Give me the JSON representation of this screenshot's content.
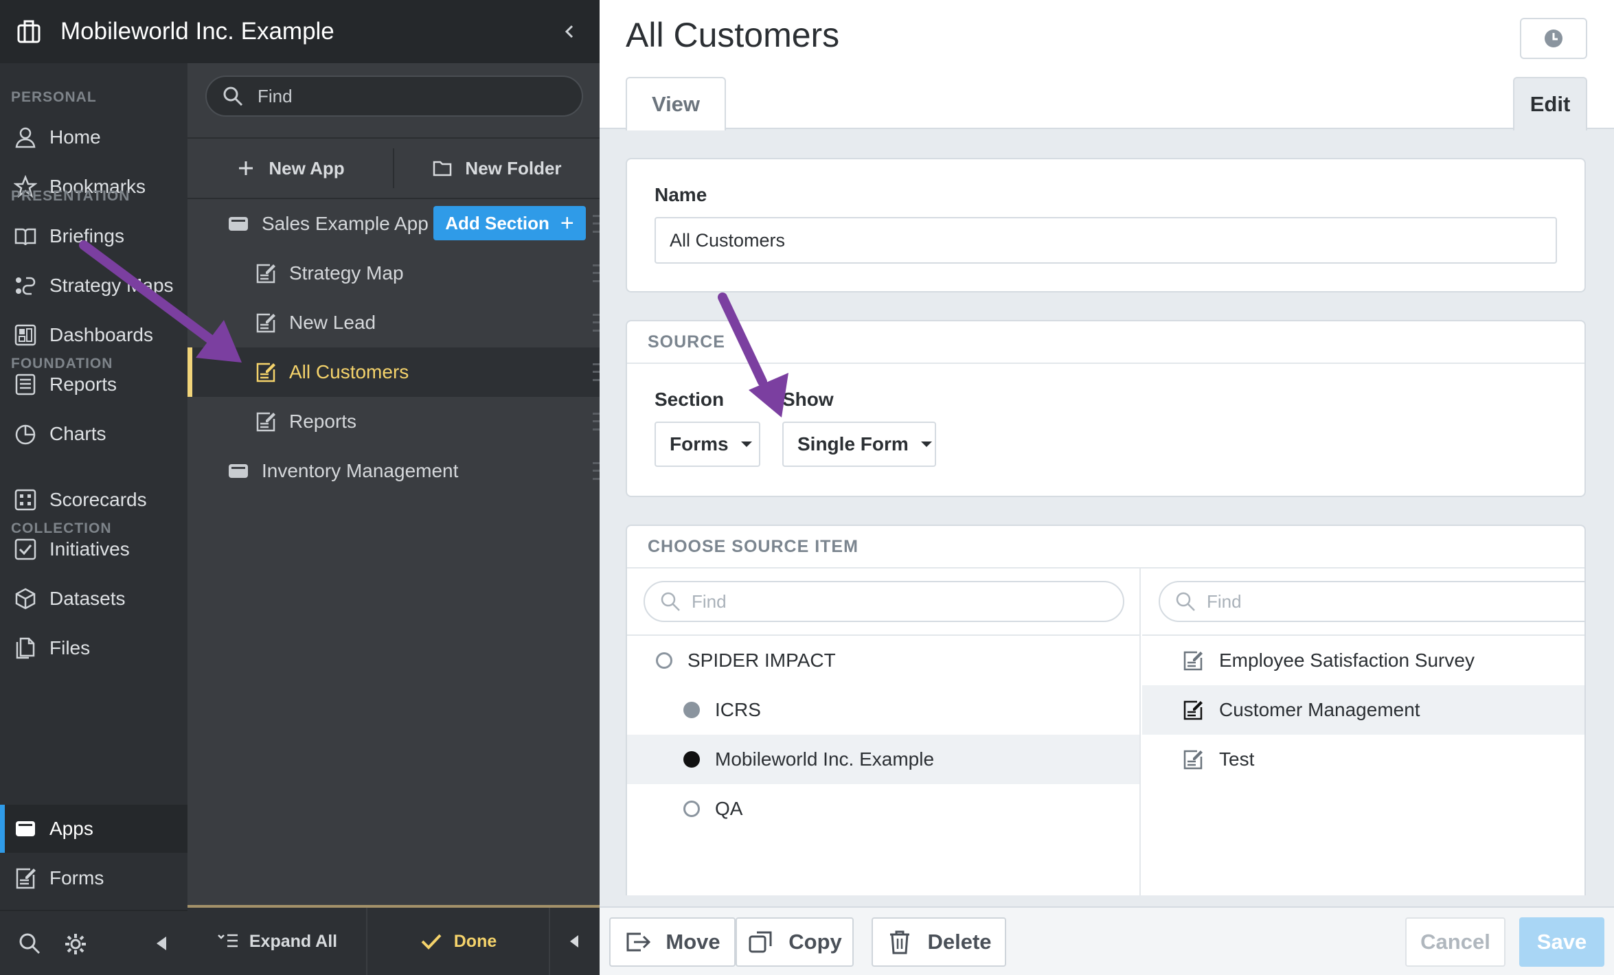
{
  "org": {
    "name": "Mobileworld Inc. Example"
  },
  "nav": {
    "sections": [
      {
        "label": "PERSONAL"
      },
      {
        "label": "PRESENTATION"
      },
      {
        "label": "FOUNDATION"
      },
      {
        "label": "COLLECTION"
      }
    ],
    "items": [
      {
        "label": "Home",
        "icon": "user-icon"
      },
      {
        "label": "Bookmarks",
        "icon": "star-icon"
      },
      {
        "label": "Briefings",
        "icon": "book-icon"
      },
      {
        "label": "Strategy Maps",
        "icon": "strategy-map-icon"
      },
      {
        "label": "Dashboards",
        "icon": "dashboard-icon"
      },
      {
        "label": "Reports",
        "icon": "report-icon"
      },
      {
        "label": "Charts",
        "icon": "pie-chart-icon"
      },
      {
        "label": "Scorecards",
        "icon": "scorecard-icon"
      },
      {
        "label": "Initiatives",
        "icon": "checkbox-icon"
      },
      {
        "label": "Datasets",
        "icon": "cube-icon"
      },
      {
        "label": "Files",
        "icon": "files-icon"
      },
      {
        "label": "Apps",
        "icon": "app-icon",
        "active": true
      },
      {
        "label": "Forms",
        "icon": "form-icon"
      }
    ]
  },
  "tree": {
    "search_placeholder": "Find",
    "new_app": "New App",
    "new_folder": "New Folder",
    "add_section": "Add Section",
    "rows": [
      {
        "label": "Sales Example App",
        "type": "app"
      },
      {
        "label": "Strategy Map",
        "type": "form"
      },
      {
        "label": "New Lead",
        "type": "form"
      },
      {
        "label": "All Customers",
        "type": "form",
        "selected": true
      },
      {
        "label": "Reports",
        "type": "form"
      },
      {
        "label": "Inventory Management",
        "type": "app"
      }
    ],
    "expand_all": "Expand All",
    "done": "Done"
  },
  "page": {
    "title": "All Customers",
    "tabs": [
      {
        "label": "View"
      },
      {
        "label": "Edit",
        "active": true
      }
    ]
  },
  "name_card": {
    "label": "Name",
    "value": "All Customers"
  },
  "source_card": {
    "header": "SOURCE",
    "section_label": "Section",
    "section_value": "Forms",
    "show_label": "Show",
    "show_value": "Single Form"
  },
  "choose_card": {
    "header": "CHOOSE SOURCE ITEM",
    "left_search_placeholder": "Find",
    "right_search_placeholder": "Find",
    "orgs": [
      {
        "label": "SPIDER IMPACT",
        "level": 0,
        "state": "empty"
      },
      {
        "label": "ICRS",
        "level": 1,
        "state": "gray"
      },
      {
        "label": "Mobileworld Inc. Example",
        "level": 1,
        "state": "filled",
        "selected": true
      },
      {
        "label": "QA",
        "level": 1,
        "state": "empty"
      }
    ],
    "forms": [
      {
        "label": "Employee Satisfaction Survey"
      },
      {
        "label": "Customer Management",
        "selected": true
      },
      {
        "label": "Test"
      }
    ]
  },
  "footer": {
    "move": "Move",
    "copy": "Copy",
    "delete": "Delete",
    "cancel": "Cancel",
    "save": "Save"
  },
  "colors": {
    "accent": "#2f9be8",
    "selected_text": "#f5d36b",
    "annotation_arrow": "#7b3fa0"
  }
}
